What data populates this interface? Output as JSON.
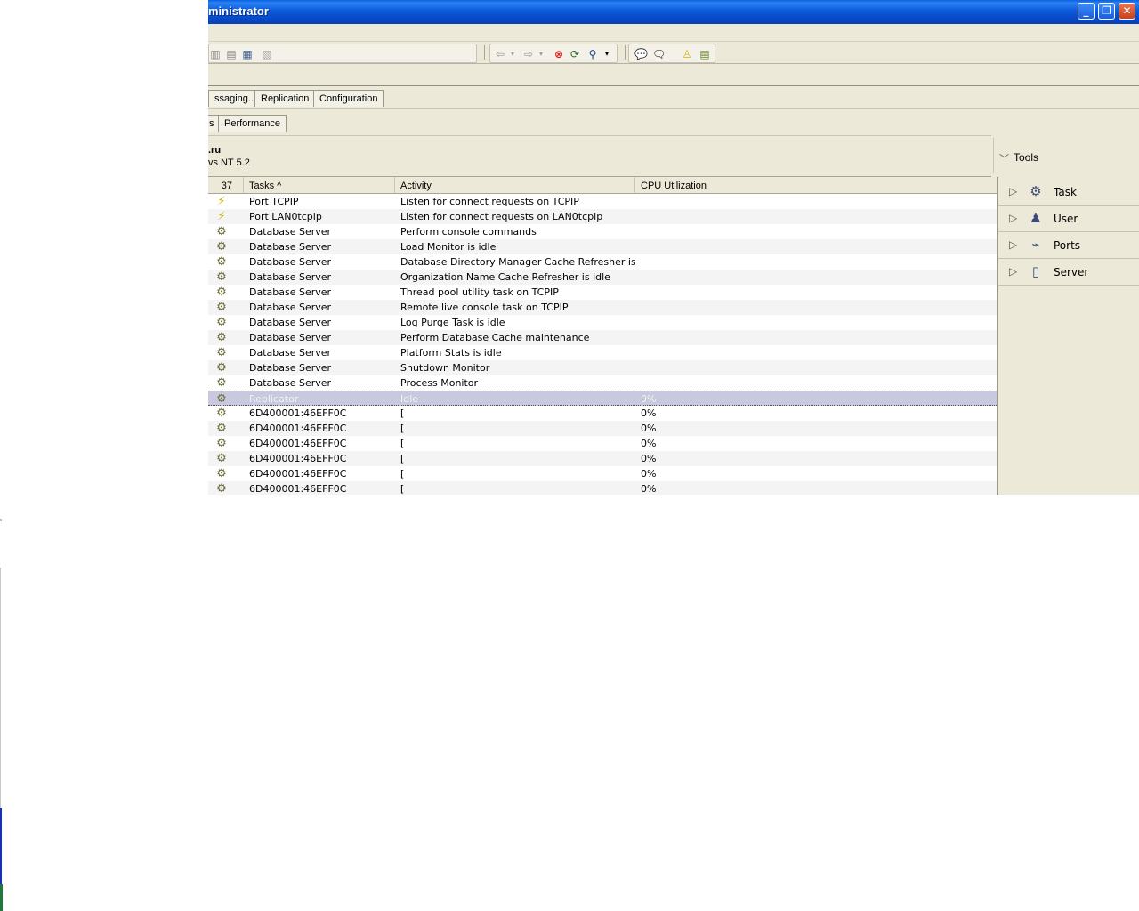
{
  "window": {
    "title": "ministrator"
  },
  "titlebar_buttons": {
    "minimize": "_",
    "maximize": "❐",
    "close": "✕"
  },
  "tabs_row1": [
    {
      "label": "ssaging..."
    },
    {
      "label": "Replication"
    },
    {
      "label": "Configuration"
    }
  ],
  "tabs_row2": [
    {
      "label": "s"
    },
    {
      "label": "Performance"
    }
  ],
  "server": {
    "name": ".ru",
    "os": "vs NT 5.2"
  },
  "tools": {
    "header": "Tools",
    "items": [
      {
        "label": "Task",
        "icon": "gear-icon"
      },
      {
        "label": "User",
        "icon": "user-icon"
      },
      {
        "label": "Ports",
        "icon": "port-icon"
      },
      {
        "label": "Server",
        "icon": "server-icon"
      }
    ]
  },
  "grid": {
    "count": "37",
    "columns": {
      "tasks": "Tasks ^",
      "activity": "Activity",
      "cpu": "CPU Utilization"
    },
    "rows": [
      {
        "icon": "port",
        "task": "Port TCPIP",
        "activity": "Listen for connect requests on TCPIP",
        "cpu": ""
      },
      {
        "icon": "port",
        "task": "Port LAN0tcpip",
        "activity": "Listen for connect requests on LAN0tcpip",
        "cpu": ""
      },
      {
        "icon": "gear",
        "task": "Database Server",
        "activity": "Perform console commands",
        "cpu": ""
      },
      {
        "icon": "gear",
        "task": "Database Server",
        "activity": "Load Monitor is idle",
        "cpu": ""
      },
      {
        "icon": "gear",
        "task": "Database Server",
        "activity": "Database Directory Manager Cache Refresher is",
        "cpu": ""
      },
      {
        "icon": "gear",
        "task": "Database Server",
        "activity": "Organization Name Cache Refresher is idle",
        "cpu": ""
      },
      {
        "icon": "gear",
        "task": "Database Server",
        "activity": "Thread pool utility task on TCPIP",
        "cpu": ""
      },
      {
        "icon": "gear",
        "task": "Database Server",
        "activity": "Remote live console task on TCPIP",
        "cpu": ""
      },
      {
        "icon": "gear",
        "task": "Database Server",
        "activity": "Log Purge Task is idle",
        "cpu": ""
      },
      {
        "icon": "gear",
        "task": "Database Server",
        "activity": "Perform Database Cache maintenance",
        "cpu": ""
      },
      {
        "icon": "gear",
        "task": "Database Server",
        "activity": "Platform Stats is idle",
        "cpu": ""
      },
      {
        "icon": "gear",
        "task": "Database Server",
        "activity": "Shutdown Monitor",
        "cpu": ""
      },
      {
        "icon": "gear",
        "task": "Database Server",
        "activity": "Process Monitor",
        "cpu": ""
      },
      {
        "icon": "gear",
        "task": "Replicator",
        "activity": "Idle",
        "cpu": "0%",
        "selected": true
      },
      {
        "icon": "gear",
        "task": "6D400001:46EFF0C",
        "activity": "[",
        "cpu": "0%"
      },
      {
        "icon": "gear",
        "task": "6D400001:46EFF0C",
        "activity": "[",
        "cpu": "0%"
      },
      {
        "icon": "gear",
        "task": "6D400001:46EFF0C",
        "activity": "[",
        "cpu": "0%"
      },
      {
        "icon": "gear",
        "task": "6D400001:46EFF0C",
        "activity": "[",
        "cpu": "0%"
      },
      {
        "icon": "gear",
        "task": "6D400001:46EFF0C",
        "activity": "[",
        "cpu": "0%"
      },
      {
        "icon": "gear",
        "task": "6D400001:46EFF0C",
        "activity": "[",
        "cpu": "0%"
      }
    ]
  }
}
